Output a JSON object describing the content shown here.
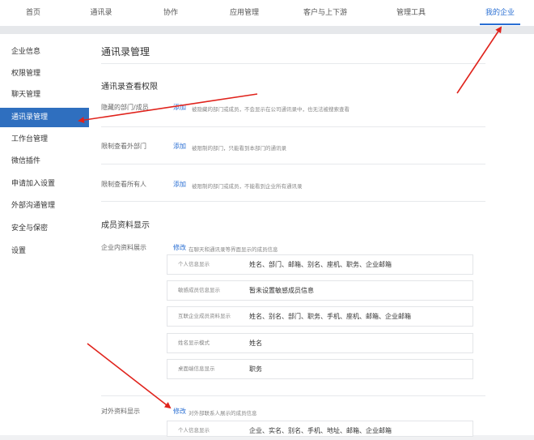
{
  "topnav": {
    "items": [
      "首页",
      "通讯录",
      "协作",
      "应用管理",
      "客户与上下游",
      "管理工具",
      "我的企业"
    ],
    "active_index": 6
  },
  "sidebar": {
    "items": [
      "企业信息",
      "权限管理",
      "聊天管理",
      "通讯录管理",
      "工作台管理",
      "微信插件",
      "申请加入设置",
      "外部沟通管理",
      "安全与保密",
      "设置"
    ],
    "active_index": 3
  },
  "main": {
    "title": "通讯录管理",
    "view_permission": {
      "title": "通讯录查看权限",
      "rows": [
        {
          "label": "隐藏的部门/成员",
          "action": "添加",
          "desc": "被隐藏的部门或成员，不会显示在公司通讯录中，也无法被搜索查看"
        },
        {
          "label": "限制查看外部门",
          "action": "添加",
          "desc": "被限制的部门，只能看到本部门的通讯录"
        },
        {
          "label": "限制查看所有人",
          "action": "添加",
          "desc": "被限制的部门或成员，不能看到企业所有通讯录"
        }
      ]
    },
    "member_display": {
      "title": "成员资料显示",
      "internal": {
        "label": "企业内资料展示",
        "action": "修改",
        "desc": "在聊天和通讯录等界面显示的成员信息",
        "boxes": [
          {
            "key": "个人信息显示",
            "value": "姓名、部门、邮箱、别名、座机、职务、企业邮箱"
          },
          {
            "key": "敏感成员信息显示",
            "value": "暂未设置敏感成员信息"
          },
          {
            "key": "互联企业成员资料显示",
            "value": "姓名、别名、部门、职务、手机、座机、邮箱、企业邮箱"
          },
          {
            "key": "姓名显示模式",
            "value": "姓名"
          },
          {
            "key": "桌面端信息显示",
            "value": "职务"
          }
        ]
      },
      "external": {
        "label": "对外资料显示",
        "action": "修改",
        "desc": "对外部联系人展示的成员信息",
        "boxes": [
          {
            "key": "个人信息显示",
            "value": "企业、实名、别名、手机、地址、邮箱、企业邮箱"
          }
        ]
      }
    }
  },
  "colors": {
    "accent": "#2a6fd3",
    "sidebar_active": "#2f6fbf",
    "arrow": "#e0231c"
  }
}
